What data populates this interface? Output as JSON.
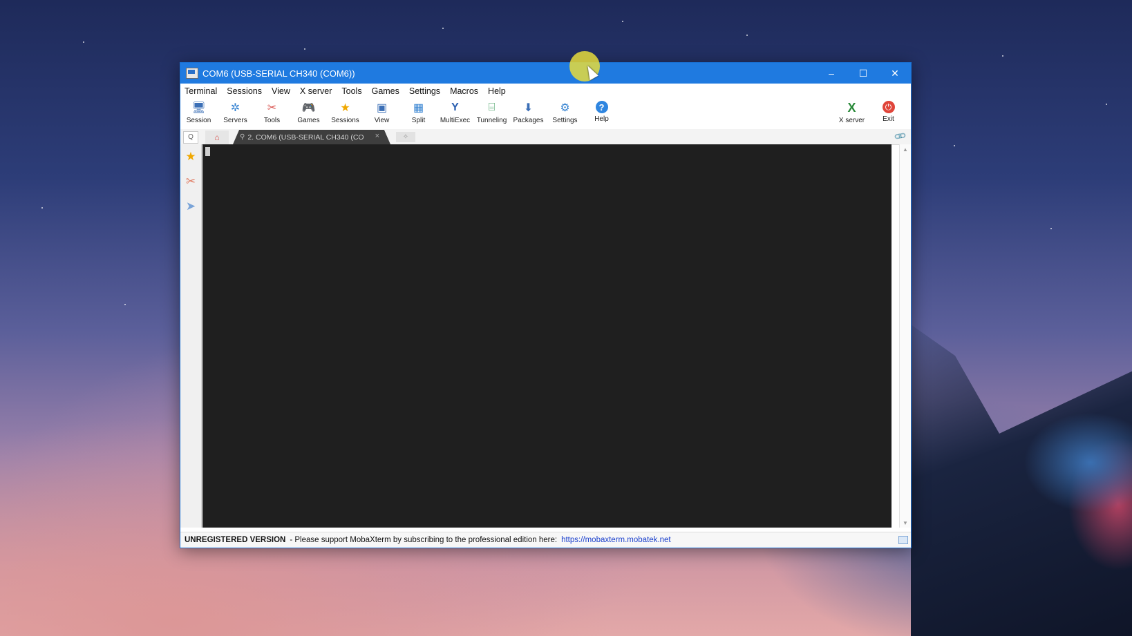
{
  "window": {
    "title": "COM6  (USB-SERIAL CH340 (COM6))",
    "controls": {
      "minimize": "–",
      "maximize": "☐",
      "close": "✕"
    }
  },
  "menu": [
    "Terminal",
    "Sessions",
    "View",
    "X server",
    "Tools",
    "Games",
    "Settings",
    "Macros",
    "Help"
  ],
  "toolbar": {
    "left": [
      {
        "label": "Session",
        "icon": "session-icon",
        "glyph": "🖥"
      },
      {
        "label": "Servers",
        "icon": "servers-icon",
        "glyph": "✲"
      },
      {
        "label": "Tools",
        "icon": "tools-icon",
        "glyph": "✂"
      },
      {
        "label": "Games",
        "icon": "games-icon",
        "glyph": "🎮"
      },
      {
        "label": "Sessions",
        "icon": "sessions-star-icon",
        "glyph": "★"
      },
      {
        "label": "View",
        "icon": "view-icon",
        "glyph": "▣"
      },
      {
        "label": "Split",
        "icon": "split-icon",
        "glyph": "▦"
      },
      {
        "label": "MultiExec",
        "icon": "multiexec-icon",
        "glyph": "Y"
      },
      {
        "label": "Tunneling",
        "icon": "tunneling-icon",
        "glyph": "⌸"
      },
      {
        "label": "Packages",
        "icon": "packages-icon",
        "glyph": "⬇"
      },
      {
        "label": "Settings",
        "icon": "settings-icon",
        "glyph": "⚙"
      },
      {
        "label": "Help",
        "icon": "help-icon",
        "glyph": "?"
      }
    ],
    "right": [
      {
        "label": "X server",
        "icon": "x-server-icon",
        "glyph": "X"
      },
      {
        "label": "Exit",
        "icon": "exit-power-icon",
        "glyph": "⏻"
      }
    ]
  },
  "tabs": {
    "search_glyph": "Q",
    "home_glyph": "⌂",
    "active_tab_label": "2. COM6  (USB-SERIAL CH340 (CO",
    "active_tab_close": "×",
    "new_tab_glyph": "✧",
    "attach_glyph": "🔗"
  },
  "sidebar": [
    {
      "icon": "favorites-star-icon",
      "glyph": "★",
      "color": "#f0a800"
    },
    {
      "icon": "tools-sidebar-icon",
      "glyph": "✂",
      "color": "#e07a60"
    },
    {
      "icon": "macros-send-icon",
      "glyph": "➤",
      "color": "#7aa4d8"
    }
  ],
  "statusbar": {
    "bold": "UNREGISTERED VERSION",
    "text": " -  Please support MobaXterm by subscribing to the professional edition here:",
    "link": "https://mobaxterm.mobatek.net"
  },
  "colors": {
    "titlebar": "#1f7ae0",
    "terminal_bg": "#1f1f1f",
    "link": "#1a3fcc"
  }
}
